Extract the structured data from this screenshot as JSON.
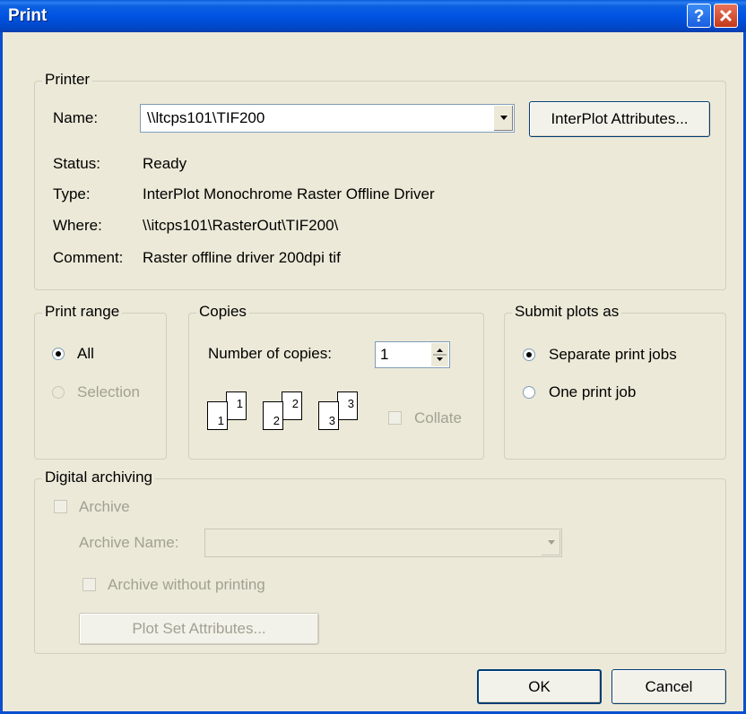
{
  "window": {
    "title": "Print"
  },
  "printer": {
    "group_label": "Printer",
    "name_label": "Name:",
    "name_value": "\\\\ltcps101\\TIF200",
    "attributes_button": "InterPlot Attributes...",
    "status_label": "Status:",
    "status_value": "Ready",
    "type_label": "Type:",
    "type_value": "InterPlot Monochrome Raster Offline Driver",
    "where_label": "Where:",
    "where_value": "\\\\itcps101\\RasterOut\\TIF200\\",
    "comment_label": "Comment:",
    "comment_value": "Raster offline driver 200dpi tif"
  },
  "print_range": {
    "group_label": "Print range",
    "all_label": "All",
    "selection_label": "Selection",
    "selected": "All"
  },
  "copies": {
    "group_label": "Copies",
    "number_label": "Number of copies:",
    "number_value": "1",
    "collate_label": "Collate",
    "collate_checked": false,
    "page_numbers": [
      "1",
      "1",
      "2",
      "2",
      "3",
      "3"
    ]
  },
  "submit": {
    "group_label": "Submit plots as",
    "separate_label": "Separate print jobs",
    "one_label": "One print job",
    "selected": "Separate print jobs"
  },
  "archiving": {
    "group_label": "Digital archiving",
    "archive_label": "Archive",
    "archive_name_label": "Archive Name:",
    "archive_name_value": "",
    "archive_without_printing_label": "Archive without printing",
    "plot_set_button": "Plot Set Attributes..."
  },
  "footer": {
    "ok_label": "OK",
    "cancel_label": "Cancel"
  },
  "colors": {
    "titlebar": "#0054e3",
    "dialog_bg": "#ece9d8",
    "disabled_text": "#a1a192"
  }
}
